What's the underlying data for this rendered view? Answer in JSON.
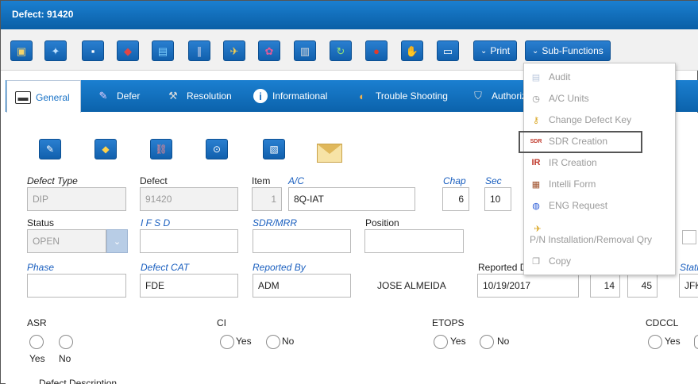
{
  "title": "Defect: 91420",
  "toolbar": {
    "print_label": "Print",
    "subfunctions_label": "Sub-Functions"
  },
  "tabs": [
    {
      "label": "General"
    },
    {
      "label": "Defer"
    },
    {
      "label": "Resolution"
    },
    {
      "label": "Informational"
    },
    {
      "label": "Trouble Shooting"
    },
    {
      "label": "Authoriz"
    }
  ],
  "subfunctions_menu": [
    {
      "label": "Audit"
    },
    {
      "label": "A/C Units"
    },
    {
      "label": "Change Defect Key"
    },
    {
      "label": "SDR Creation"
    },
    {
      "label": "IR Creation"
    },
    {
      "label": "Intelli Form"
    },
    {
      "label": "ENG Request"
    },
    {
      "label": "P/N Installation/Removal Qry"
    },
    {
      "label": "Copy"
    }
  ],
  "form": {
    "defect_type_label": "Defect Type",
    "defect_type_value": "DIP",
    "defect_label": "Defect",
    "defect_value": "91420",
    "item_label": "Item",
    "item_value": "1",
    "ac_label": "A/C",
    "ac_value": "8Q-IAT",
    "chap_label": "Chap",
    "chap_value": "6",
    "sec_label": "Sec",
    "sec_value": "10",
    "status_label": "Status",
    "status_value": "OPEN",
    "ifsd_label": "I F S D",
    "sdr_mrr_label": "SDR/MRR",
    "position_label": "Position",
    "phase_label": "Phase",
    "defect_cat_label": "Defect CAT",
    "defect_cat_value": "FDE",
    "reported_by_label": "Reported By",
    "reported_by_value": "ADM",
    "reporter_name": "JOSE ALMEIDA",
    "reported_date_label": "Reported D",
    "reported_date_value": "10/19/2017",
    "hour_value": "14",
    "minute_value": "45",
    "station_label": "Statio",
    "station_value": "JFK",
    "asr_label": "ASR",
    "ci_label": "CI",
    "etops_label": "ETOPS",
    "cdccl_label": "CDCCL",
    "yes_label": "Yes",
    "no_label": "No",
    "defect_description_label": "Defect Description"
  }
}
